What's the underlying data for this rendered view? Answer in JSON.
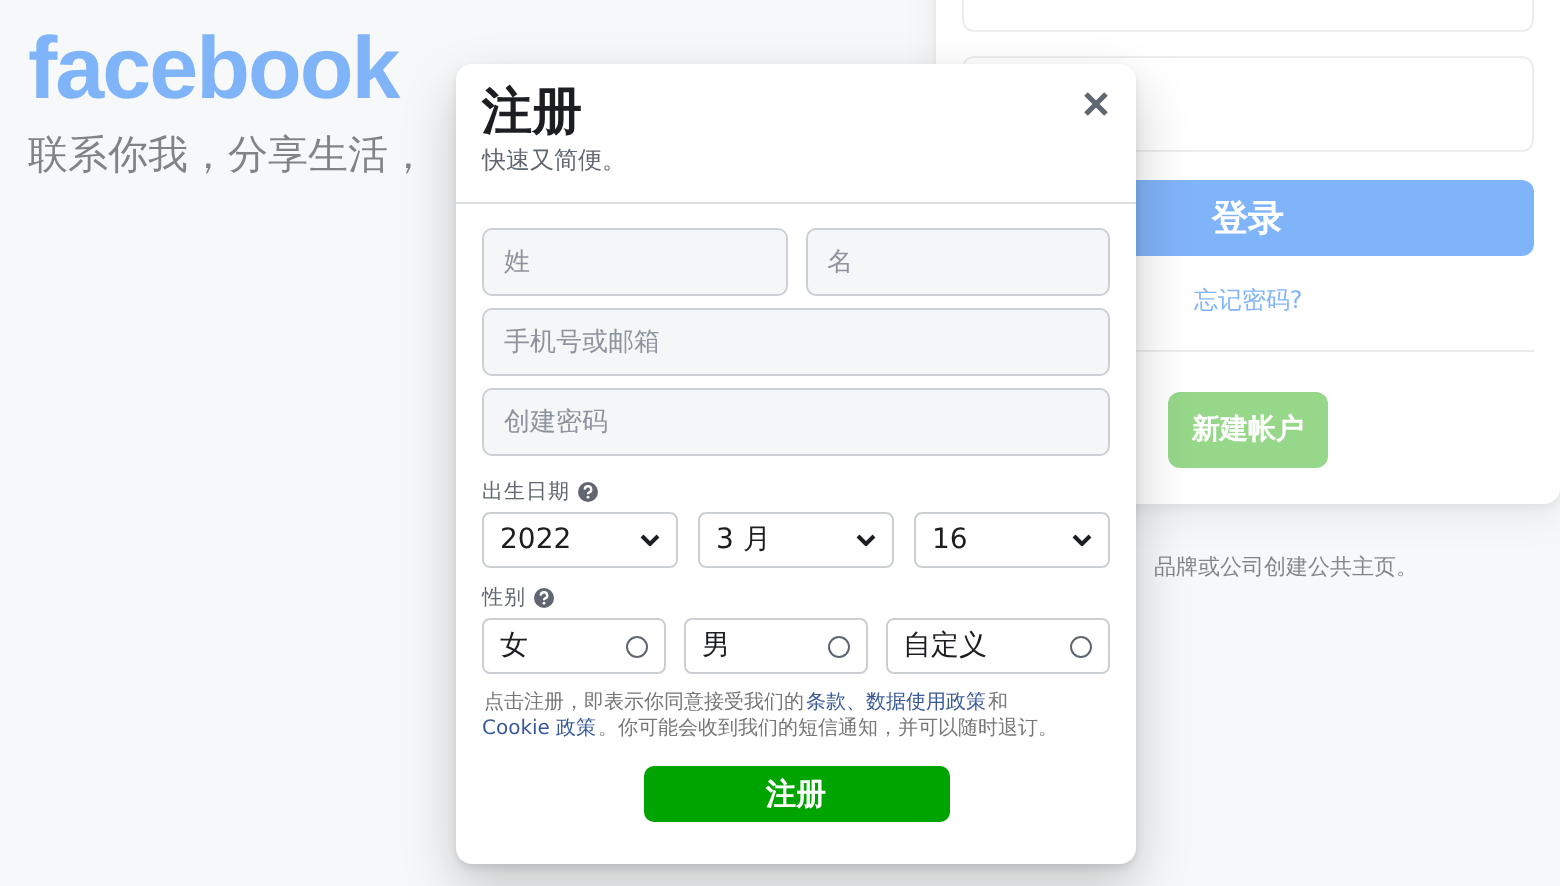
{
  "background": {
    "logo": "facebook",
    "tagline": "联系你我，分享生活，",
    "login": {
      "login_button": "登录",
      "forgot_link": "忘记密码?",
      "create_button": "新建帐户",
      "page_note": "品牌或公司创建公共主页。"
    }
  },
  "dialog": {
    "title": "注册",
    "subtitle": "快速又简便。",
    "name_fields": [
      {
        "placeholder": "姓"
      },
      {
        "placeholder": "名"
      }
    ],
    "contact_field": {
      "placeholder": "手机号或邮箱"
    },
    "password_field": {
      "placeholder": "创建密码"
    },
    "birthday": {
      "label": "出生日期",
      "selects": [
        {
          "value": "2022"
        },
        {
          "value": "3 月"
        },
        {
          "value": "16"
        }
      ]
    },
    "gender": {
      "label": "性别",
      "options": [
        {
          "label": "女",
          "selected": false
        },
        {
          "label": "男",
          "selected": false
        },
        {
          "label": "自定义",
          "selected": false
        }
      ]
    },
    "terms": [
      {
        "kind": "text",
        "text": "点击注册，即表示你同意接受我们的"
      },
      {
        "kind": "link",
        "text": "条款、"
      },
      {
        "kind": "link",
        "text": "数据使用政策"
      },
      {
        "kind": "text",
        "text": "和 "
      },
      {
        "kind": "link",
        "text": "Cookie 政策"
      },
      {
        "kind": "text",
        "text": "。你可能会收到我们的短信通知，并可以随时退订。"
      }
    ],
    "submit": "注册"
  }
}
